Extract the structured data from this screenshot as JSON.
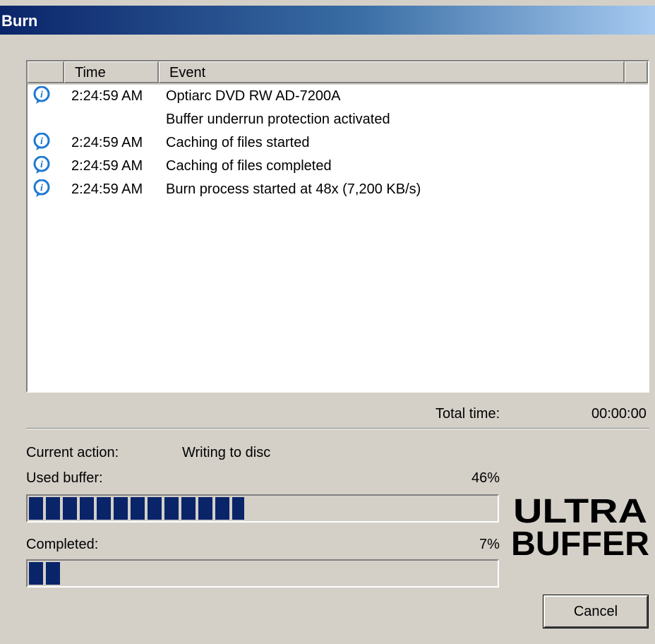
{
  "window": {
    "title": "Burn"
  },
  "log": {
    "columns": {
      "time": "Time",
      "event": "Event"
    },
    "rows": [
      {
        "icon": "info-icon",
        "time": "2:24:59 AM",
        "event": "Optiarc DVD RW AD-7200A"
      },
      {
        "icon": "",
        "time": "",
        "event": "Buffer underrun protection activated"
      },
      {
        "icon": "info-icon",
        "time": "2:24:59 AM",
        "event": "Caching of files started"
      },
      {
        "icon": "info-icon",
        "time": "2:24:59 AM",
        "event": "Caching of files completed"
      },
      {
        "icon": "info-icon",
        "time": "2:24:59 AM",
        "event": "Burn process started at 48x (7,200 KB/s)"
      }
    ]
  },
  "total_time": {
    "label": "Total time:",
    "value": "00:00:00"
  },
  "current_action": {
    "label": "Current action:",
    "value": "Writing to disc"
  },
  "used_buffer": {
    "label": "Used buffer:",
    "percent_text": "46%",
    "fraction": 0.46
  },
  "completed": {
    "label": "Completed:",
    "percent_text": "7%",
    "fraction": 0.07
  },
  "logo": {
    "line1": "ULTRA",
    "line2": "BUFFER"
  },
  "buttons": {
    "cancel": "Cancel"
  },
  "colors": {
    "accent": "#0a246a",
    "info_icon": "#1e78d2"
  }
}
